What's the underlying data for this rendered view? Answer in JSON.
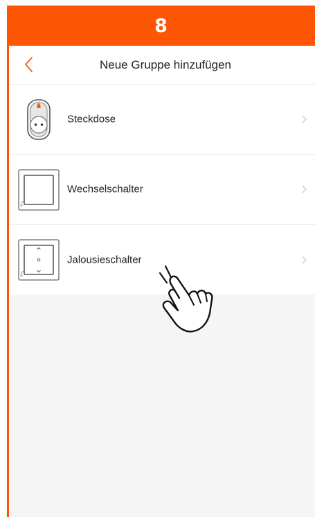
{
  "step": {
    "number": "8"
  },
  "navbar": {
    "title": "Neue Gruppe hinzufügen",
    "back_icon": "chevron-left-icon"
  },
  "groups": [
    {
      "label": "Steckdose",
      "icon": "socket-outlet-icon"
    },
    {
      "label": "Wechselschalter",
      "icon": "rocker-switch-icon"
    },
    {
      "label": "Jalousieschalter",
      "icon": "blind-switch-icon"
    }
  ],
  "colors": {
    "accent": "#fd5605",
    "list_background": "#ffffff",
    "screen_background": "#f5f5f5",
    "text": "#222222",
    "chevron": "#c8c8c8"
  }
}
